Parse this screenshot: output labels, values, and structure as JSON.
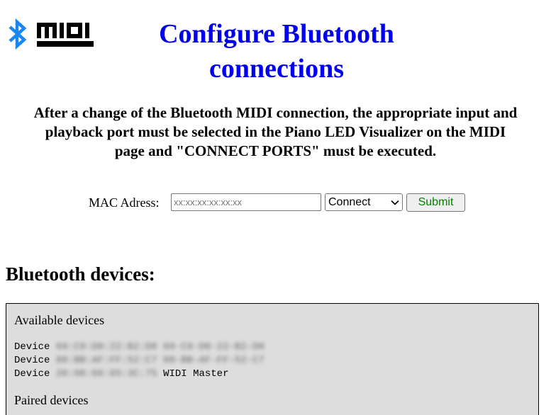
{
  "header": {
    "title_line1": "Configure Bluetooth",
    "title_line2": "connections",
    "bluetooth_icon": "bluetooth-icon",
    "midi_logo_text": "MIDI"
  },
  "notice": {
    "line1": "After a change of the Bluetooth MIDI connection, the appropriate input and",
    "line2": "playback port must be selected in the Piano LED Visualizer on the MIDI",
    "line3": "page and \"CONNECT PORTS\" must be executed."
  },
  "form": {
    "mac_label": "MAC Adress:",
    "mac_placeholder": "xx:xx:xx:xx:xx:xx",
    "mac_value": "",
    "action_selected": "Connect",
    "submit_label": "Submit"
  },
  "devices": {
    "heading": "Bluetooth devices:",
    "available_label": "Available devices",
    "available": [
      {
        "prefix": "Device",
        "address": "69:C9:D0:22:B2:D0",
        "name": "69-C9-D0-22-B2-D0"
      },
      {
        "prefix": "Device",
        "address": "88:BB:AF:FF:52:C7",
        "name": "88-BB-AF-FF-52-C7"
      },
      {
        "prefix": "Device",
        "address": "20:98:66:65:3C:75",
        "name": "WIDI Master"
      }
    ],
    "paired_label": "Paired devices"
  },
  "colors": {
    "title": "#0000ee",
    "submit_text": "#008000",
    "bluetooth_icon": "#1a86f0",
    "devices_bg": "#dddddd"
  }
}
